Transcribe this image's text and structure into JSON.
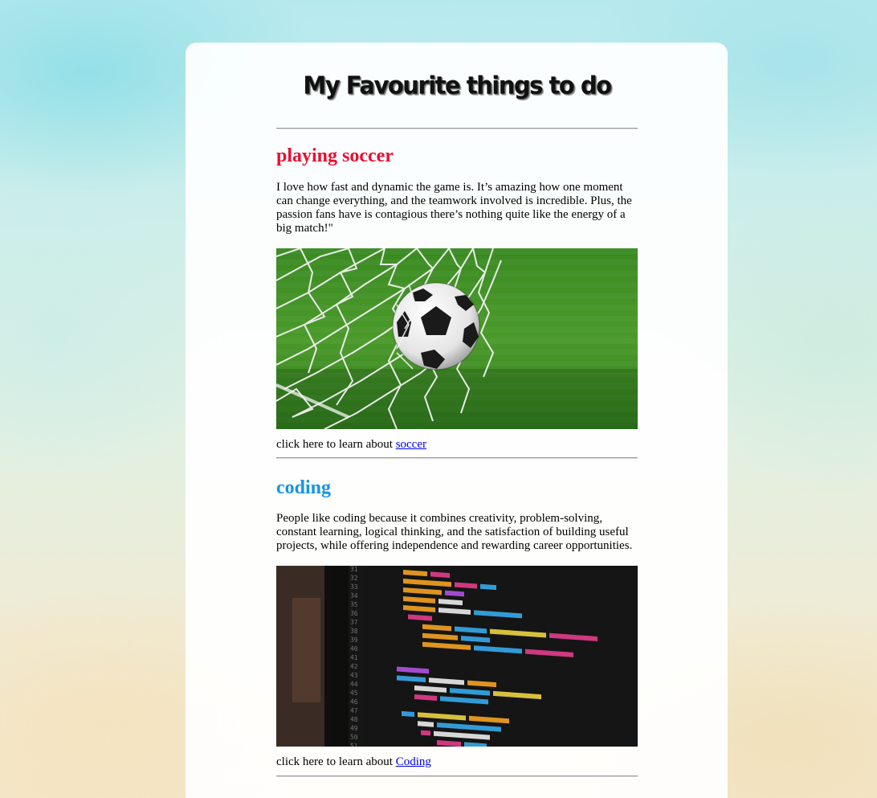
{
  "page": {
    "title": "My Favourite things to do"
  },
  "sections": [
    {
      "title": "playing soccer",
      "title_color": "#e8102f",
      "text": "I love how fast and dynamic the game is. It’s amazing how one moment can change everything, and the teamwork involved is incredible. Plus, the passion fans have is contagious there’s nothing quite like the energy of a big match!\"",
      "image_icon": "soccer-ball-in-net",
      "learn_prefix": "click here to learn about ",
      "link_label": "soccer"
    },
    {
      "title": "coding",
      "title_color": "#1593e6",
      "text": "People like coding because it combines creativity, problem-solving, constant learning, logical thinking, and the satisfaction of building useful projects, while offering independence and rewarding career opportunities.",
      "image_icon": "code-on-monitor",
      "learn_prefix": "click here to learn about ",
      "link_label": "Coding"
    }
  ]
}
